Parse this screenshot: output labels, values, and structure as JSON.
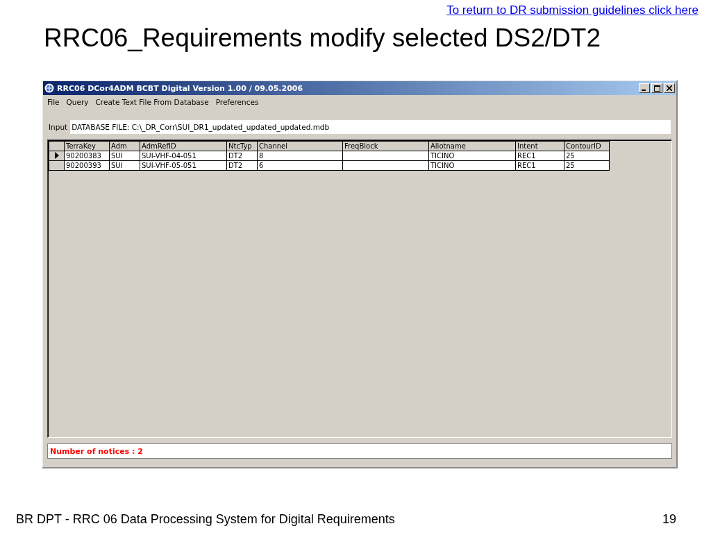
{
  "slide": {
    "link": "To return to DR submission guidelines click here",
    "title": "RRC06_Requirements modify selected DS2/DT2",
    "footer": "BR DPT - RRC 06 Data Processing System for Digital Requirements",
    "page_number": "19"
  },
  "window": {
    "title": "RRC06 DCor4ADM BCBT Digital Version 1.00 / 09.05.2006"
  },
  "menu": [
    "File",
    "Query",
    "Create Text File From Database",
    "Preferences"
  ],
  "input": {
    "label": "Input",
    "value": "DATABASE FILE: C:\\_DR_Corr\\SUI_DR1_updated_updated_updated.mdb"
  },
  "table": {
    "columns": [
      "TerraKey",
      "Adm",
      "AdmRefID",
      "NtcTyp",
      "Channel",
      "FreqBlock",
      "Allotname",
      "Intent",
      "ContourID"
    ],
    "rows": [
      {
        "selected": true,
        "cells": [
          "90200383",
          "SUI",
          "SUI-VHF-04-051",
          "DT2",
          "8",
          "",
          "TICINO",
          "REC1",
          "25"
        ]
      },
      {
        "selected": false,
        "cells": [
          "90200393",
          "SUI",
          "SUI-VHF-05-051",
          "DT2",
          "6",
          "",
          "TICINO",
          "REC1",
          "25"
        ]
      }
    ]
  },
  "status": "Number of notices : 2"
}
